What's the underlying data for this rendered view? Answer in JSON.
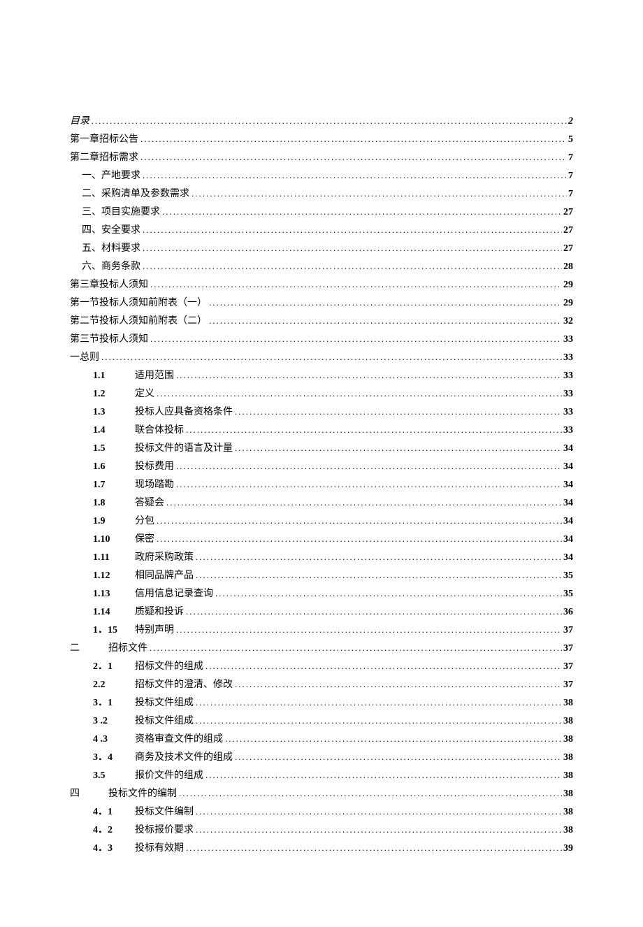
{
  "toc": [
    {
      "level": 0,
      "num": "",
      "title": "目录",
      "page": "2",
      "italic": true
    },
    {
      "level": 0,
      "num": "",
      "title": "第一章招标公告",
      "page": "5"
    },
    {
      "level": 0,
      "num": "",
      "title": "第二章招标需求",
      "page": "7"
    },
    {
      "level": 1,
      "num": "",
      "title": "一、产地要求",
      "page": "7"
    },
    {
      "level": 1,
      "num": "",
      "title": "二、采购清单及参数需求",
      "page": "7"
    },
    {
      "level": 1,
      "num": "",
      "title": "三、项目实施要求",
      "page": "27"
    },
    {
      "level": 1,
      "num": "",
      "title": "四、安全要求",
      "page": "27"
    },
    {
      "level": 1,
      "num": "",
      "title": "五、材料要求",
      "page": "27"
    },
    {
      "level": 1,
      "num": "",
      "title": "六、商务条款",
      "page": "28"
    },
    {
      "level": 0,
      "num": "",
      "title": "第三章投标人须知",
      "page": "29"
    },
    {
      "level": 0,
      "num": "",
      "title": "第一节投标人须知前附表（一）",
      "page": "29"
    },
    {
      "level": 0,
      "num": "",
      "title": "第二节投标人须知前附表（二）",
      "page": "32"
    },
    {
      "level": 0,
      "num": "",
      "title": "第三节投标人须知",
      "page": "33"
    },
    {
      "level": 0,
      "num": "",
      "title": "一总则",
      "page": "33"
    },
    {
      "level": 2,
      "num": "1.1",
      "title": "适用范围",
      "page": "33"
    },
    {
      "level": 2,
      "num": "1.2",
      "title": "定义",
      "page": "33"
    },
    {
      "level": 2,
      "num": "1.3",
      "title": "投标人应具备资格条件",
      "page": "33"
    },
    {
      "level": 2,
      "num": "1.4",
      "title": "联合体投标",
      "page": "33"
    },
    {
      "level": 2,
      "num": "1.5",
      "title": "投标文件的语言及计量",
      "page": "34"
    },
    {
      "level": 2,
      "num": "1.6",
      "title": "投标费用",
      "page": "34"
    },
    {
      "level": 2,
      "num": "1.7",
      "title": "现场踏勘",
      "page": "34"
    },
    {
      "level": 2,
      "num": "1.8",
      "title": "答疑会",
      "page": "34"
    },
    {
      "level": 2,
      "num": "1.9",
      "title": "分包",
      "page": "34"
    },
    {
      "level": 2,
      "num": "1.10",
      "title": "保密",
      "page": "34"
    },
    {
      "level": 2,
      "num": "1.11",
      "title": "政府采购政策",
      "page": "34"
    },
    {
      "level": 2,
      "num": "1.12",
      "title": "相同品牌产品",
      "page": "35"
    },
    {
      "level": 2,
      "num": "1.13",
      "title": "信用信息记录查询",
      "page": "35"
    },
    {
      "level": 2,
      "num": "1.14",
      "title": "质疑和投诉",
      "page": "36"
    },
    {
      "level": 2,
      "num": "1．15",
      "title": "特别声明",
      "page": "37"
    },
    {
      "level": 0,
      "num": "二",
      "title": "招标文件",
      "page": "37",
      "cnNum": true
    },
    {
      "level": 2,
      "num": "2．1",
      "title": "招标文件的组成",
      "page": "37"
    },
    {
      "level": 2,
      "num": "2.2",
      "title": "招标文件的澄清、修改",
      "page": "37"
    },
    {
      "level": 2,
      "num": "3．1",
      "title": "投标文件组成",
      "page": "38"
    },
    {
      "level": 2,
      "num": "3 .2",
      "title": "投标文件组成",
      "page": "38"
    },
    {
      "level": 2,
      "num": "4 .3",
      "title": "资格审查文件的组成",
      "page": "38"
    },
    {
      "level": 2,
      "num": "3．4",
      "title": "商务及技术文件的组成",
      "page": "38"
    },
    {
      "level": 2,
      "num": "3.5",
      "title": "报价文件的组成",
      "page": "38"
    },
    {
      "level": 0,
      "num": "四",
      "title": "投标文件的编制",
      "page": "38",
      "cnNum": true
    },
    {
      "level": 2,
      "num": "4．1",
      "title": "投标文件编制",
      "page": "38"
    },
    {
      "level": 2,
      "num": "4．2",
      "title": "投标报价要求",
      "page": "38"
    },
    {
      "level": 2,
      "num": "4．3",
      "title": "投标有效期",
      "page": "39"
    }
  ]
}
